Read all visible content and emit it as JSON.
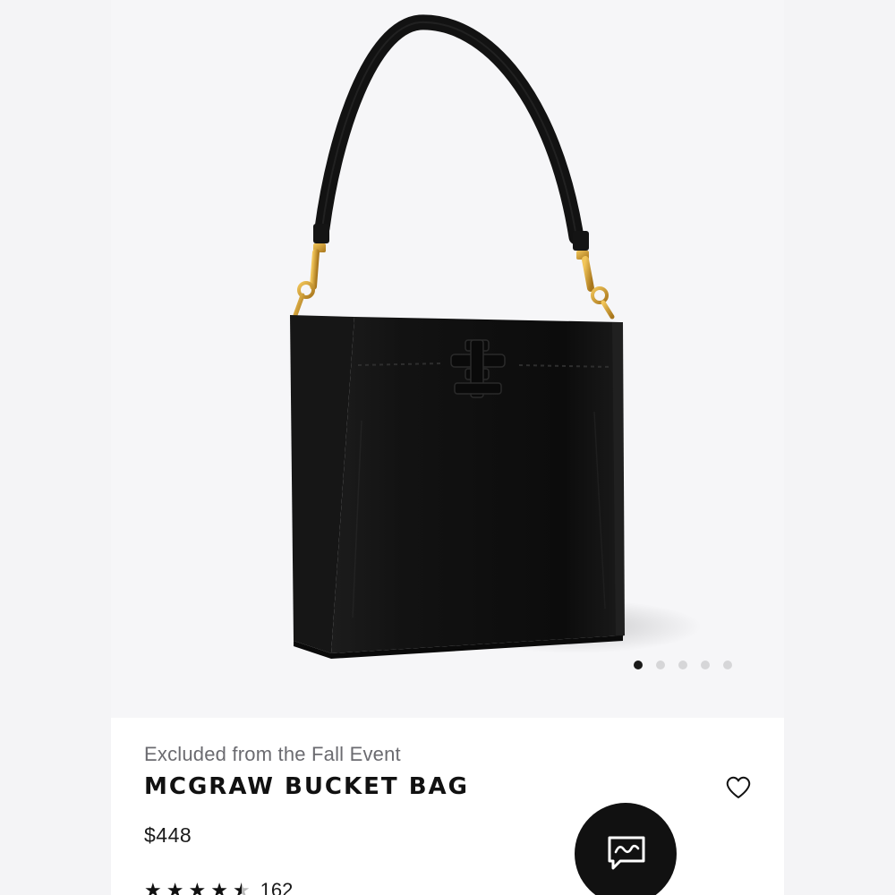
{
  "gallery": {
    "image_alt": "Black pebbled leather bucket bag with shoulder strap and gold hardware",
    "dots_total": 5,
    "dots_active_index": 0
  },
  "product": {
    "promo_note": "Excluded from the Fall Event",
    "name": "MCGRAW BUCKET BAG",
    "price": "$448",
    "rating": 4.5,
    "review_count": "162"
  },
  "icons": {
    "wishlist": "heart-outline-icon",
    "chat": "chat-bubble-icon",
    "stars": "star-icon"
  },
  "colors": {
    "background": "#f4f4f6",
    "text": "#111111",
    "muted": "#6b6b70",
    "chat_button": "#111111"
  }
}
